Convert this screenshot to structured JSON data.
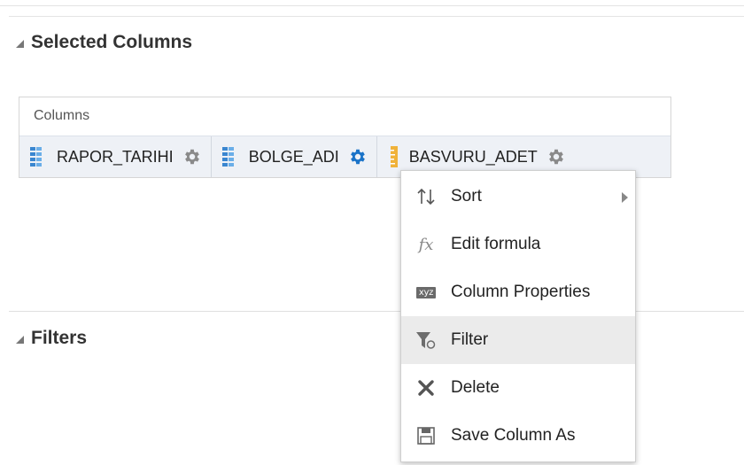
{
  "sections": {
    "selected_columns": {
      "title": "Selected Columns"
    },
    "filters": {
      "title": "Filters"
    }
  },
  "columns_panel": {
    "label": "Columns",
    "items": [
      {
        "name": "RAPOR_TARIHI",
        "type_icon": "grid-column-icon",
        "gear_state": "normal"
      },
      {
        "name": "BOLGE_ADI",
        "type_icon": "grid-column-icon",
        "gear_state": "active"
      },
      {
        "name": "BASVURU_ADET",
        "type_icon": "ruler-measure-icon",
        "gear_state": "normal"
      }
    ]
  },
  "context_menu": {
    "items": [
      {
        "label": "Sort",
        "icon": "sort-arrows-icon",
        "has_submenu": true
      },
      {
        "label": "Edit formula",
        "icon": "fx-icon",
        "has_submenu": false
      },
      {
        "label": "Column Properties",
        "icon": "xyz-properties-icon",
        "icon_text": "xyz",
        "has_submenu": false
      },
      {
        "label": "Filter",
        "icon": "filter-funnel-icon",
        "has_submenu": false,
        "hovered": true
      },
      {
        "label": "Delete",
        "icon": "delete-x-icon",
        "has_submenu": false
      },
      {
        "label": "Save Column As",
        "icon": "save-disk-icon",
        "has_submenu": false
      }
    ]
  },
  "colors": {
    "gear_active": "#1a73c8",
    "gear_normal": "#8a8a8a",
    "grid_icon": "#3a86d0",
    "ruler_icon": "#f0b23a",
    "menu_hover": "#ebebeb"
  }
}
